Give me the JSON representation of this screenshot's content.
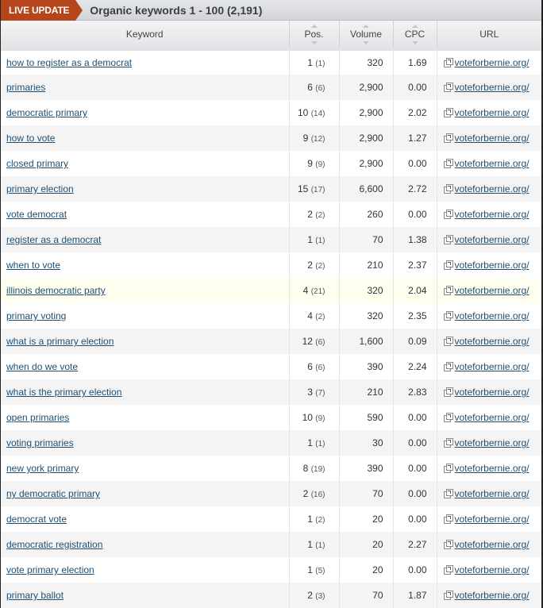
{
  "header": {
    "badge": "LIVE UPDATE",
    "title": "Organic keywords 1 - 100 (2,191)"
  },
  "columns": {
    "keyword": "Keyword",
    "pos": "Pos.",
    "volume": "Volume",
    "cpc": "CPC",
    "url": "URL"
  },
  "rows": [
    {
      "keyword": "how to register as a democrat",
      "pos": "1",
      "prev": "(1)",
      "volume": "320",
      "cpc": "1.69",
      "url": "voteforbernie.org/"
    },
    {
      "keyword": "primaries",
      "pos": "6",
      "prev": "(6)",
      "volume": "2,900",
      "cpc": "0.00",
      "url": "voteforbernie.org/"
    },
    {
      "keyword": "democratic primary",
      "pos": "10",
      "prev": "(14)",
      "volume": "2,900",
      "cpc": "2.02",
      "url": "voteforbernie.org/"
    },
    {
      "keyword": "how to vote",
      "pos": "9",
      "prev": "(12)",
      "volume": "2,900",
      "cpc": "1.27",
      "url": "voteforbernie.org/"
    },
    {
      "keyword": "closed primary",
      "pos": "9",
      "prev": "(9)",
      "volume": "2,900",
      "cpc": "0.00",
      "url": "voteforbernie.org/"
    },
    {
      "keyword": "primary election",
      "pos": "15",
      "prev": "(17)",
      "volume": "6,600",
      "cpc": "2.72",
      "url": "voteforbernie.org/"
    },
    {
      "keyword": "vote democrat",
      "pos": "2",
      "prev": "(2)",
      "volume": "260",
      "cpc": "0.00",
      "url": "voteforbernie.org/"
    },
    {
      "keyword": "register as a democrat",
      "pos": "1",
      "prev": "(1)",
      "volume": "70",
      "cpc": "1.38",
      "url": "voteforbernie.org/"
    },
    {
      "keyword": "when to vote",
      "pos": "2",
      "prev": "(2)",
      "volume": "210",
      "cpc": "2.37",
      "url": "voteforbernie.org/"
    },
    {
      "keyword": "illinois democratic party",
      "pos": "4",
      "prev": "(21)",
      "volume": "320",
      "cpc": "2.04",
      "url": "voteforbernie.org/",
      "highlighted": true
    },
    {
      "keyword": "primary voting",
      "pos": "4",
      "prev": "(2)",
      "volume": "320",
      "cpc": "2.35",
      "url": "voteforbernie.org/"
    },
    {
      "keyword": "what is a primary election",
      "pos": "12",
      "prev": "(6)",
      "volume": "1,600",
      "cpc": "0.09",
      "url": "voteforbernie.org/"
    },
    {
      "keyword": "when do we vote",
      "pos": "6",
      "prev": "(6)",
      "volume": "390",
      "cpc": "2.24",
      "url": "voteforbernie.org/"
    },
    {
      "keyword": "what is the primary election",
      "pos": "3",
      "prev": "(7)",
      "volume": "210",
      "cpc": "2.83",
      "url": "voteforbernie.org/"
    },
    {
      "keyword": "open primaries",
      "pos": "10",
      "prev": "(9)",
      "volume": "590",
      "cpc": "0.00",
      "url": "voteforbernie.org/"
    },
    {
      "keyword": "voting primaries",
      "pos": "1",
      "prev": "(1)",
      "volume": "30",
      "cpc": "0.00",
      "url": "voteforbernie.org/"
    },
    {
      "keyword": "new york primary",
      "pos": "8",
      "prev": "(19)",
      "volume": "390",
      "cpc": "0.00",
      "url": "voteforbernie.org/"
    },
    {
      "keyword": "ny democratic primary",
      "pos": "2",
      "prev": "(16)",
      "volume": "70",
      "cpc": "0.00",
      "url": "voteforbernie.org/"
    },
    {
      "keyword": "democrat vote",
      "pos": "1",
      "prev": "(2)",
      "volume": "20",
      "cpc": "0.00",
      "url": "voteforbernie.org/"
    },
    {
      "keyword": "democratic registration",
      "pos": "1",
      "prev": "(1)",
      "volume": "20",
      "cpc": "2.27",
      "url": "voteforbernie.org/"
    },
    {
      "keyword": "vote primary election",
      "pos": "1",
      "prev": "(5)",
      "volume": "20",
      "cpc": "0.00",
      "url": "voteforbernie.org/"
    },
    {
      "keyword": "primary ballot",
      "pos": "2",
      "prev": "(3)",
      "volume": "70",
      "cpc": "1.87",
      "url": "voteforbernie.org/"
    }
  ],
  "colors": {
    "badge": "#b5451b",
    "link": "#1f4f74",
    "row_alt": "#f4f4f4",
    "row_highlight": "#fffff0"
  },
  "icons": {
    "url_link": "external-link-icon",
    "sort_up": "sort-asc-icon",
    "sort_down": "sort-desc-icon"
  }
}
